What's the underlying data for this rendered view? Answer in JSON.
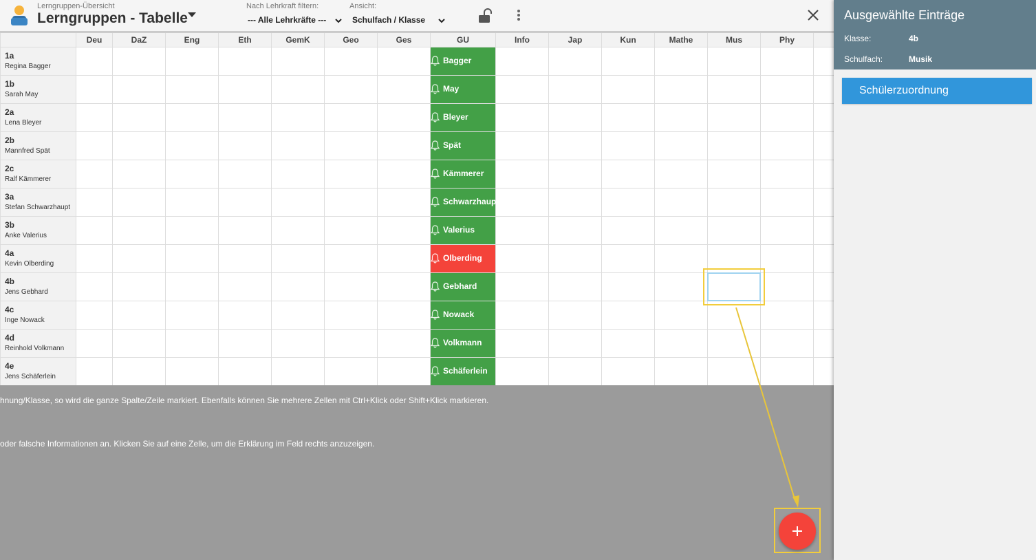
{
  "header": {
    "breadcrumb": "Lerngruppen-Übersicht",
    "title": "Lerngruppen - Tabelle",
    "filter_label": "Nach Lehrkraft filtern:",
    "filter_value": "--- Alle Lehrkräfte ---",
    "view_label": "Ansicht:",
    "view_value": "Schulfach / Klasse"
  },
  "columns": [
    "Deu",
    "DaZ",
    "Eng",
    "Eth",
    "GemK",
    "Geo",
    "Ges",
    "GU",
    "Info",
    "Jap",
    "Kun",
    "Mathe",
    "Mus",
    "Phy",
    ""
  ],
  "rows": [
    {
      "class": "1a",
      "teacher": "Regina Bagger",
      "gu": "Bagger",
      "warn": false
    },
    {
      "class": "1b",
      "teacher": "Sarah May",
      "gu": "May",
      "warn": false
    },
    {
      "class": "2a",
      "teacher": "Lena Bleyer",
      "gu": "Bleyer",
      "warn": false
    },
    {
      "class": "2b",
      "teacher": "Mannfred Spät",
      "gu": "Spät",
      "warn": false
    },
    {
      "class": "2c",
      "teacher": "Ralf Kämmerer",
      "gu": "Kämmerer",
      "warn": false
    },
    {
      "class": "3a",
      "teacher": "Stefan Schwarzhaupt",
      "gu": "Schwarzhaupt",
      "warn": false
    },
    {
      "class": "3b",
      "teacher": "Anke Valerius",
      "gu": "Valerius",
      "warn": false
    },
    {
      "class": "4a",
      "teacher": "Kevin Olberding",
      "gu": "Olberding",
      "warn": true
    },
    {
      "class": "4b",
      "teacher": "Jens Gebhard",
      "gu": "Gebhard",
      "warn": false
    },
    {
      "class": "4c",
      "teacher": "Inge Nowack",
      "gu": "Nowack",
      "warn": false
    },
    {
      "class": "4d",
      "teacher": "Reinhold Volkmann",
      "gu": "Volkmann",
      "warn": false
    },
    {
      "class": "4e",
      "teacher": "Jens Schäferlein",
      "gu": "Schäferlein",
      "warn": false
    }
  ],
  "info": {
    "line1": "hnung/Klasse, so wird die ganze Spalte/Zeile markiert. Ebenfalls können Sie mehrere Zellen mit Ctrl+Klick oder Shift+Klick markieren.",
    "line2": "oder falsche Informationen an. Klicken Sie auf eine Zelle, um die Erklärung im Feld rechts anzuzeigen."
  },
  "side_panel": {
    "title": "Ausgewählte Einträge",
    "class_label": "Klasse:",
    "class_value": "4b",
    "subject_label": "Schulfach:",
    "subject_value": "Musik",
    "assign_button": "Schülerzuordnung"
  },
  "colors": {
    "gu_ok": "#43a047",
    "gu_warn": "#f4433a",
    "panel_header": "#627e8c",
    "assign_button": "#3196db",
    "fab": "#f4433a",
    "highlight": "#f2cd3c"
  },
  "icons": {
    "avatar": "person-avatar-icon",
    "dropdown": "caret-down-icon",
    "lock": "unlock-icon",
    "menu": "more-vertical-icon",
    "close": "close-icon",
    "bell": "bell-icon",
    "fab": "plus-icon"
  }
}
